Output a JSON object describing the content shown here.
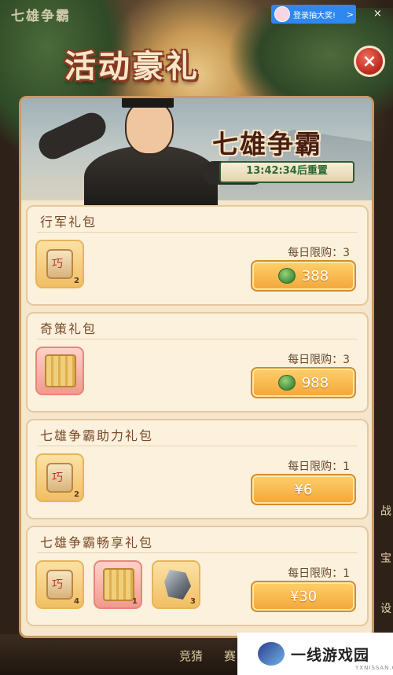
{
  "background": {
    "top_text": "七雄争霸",
    "bottom_left": "竞猜",
    "bottom_right": "赛",
    "side_chars": [
      "战",
      "宝",
      "设"
    ]
  },
  "ad": {
    "label": "登录抽大奖!",
    "chevron": ">",
    "close": "×"
  },
  "popup": {
    "title": "活动豪礼",
    "close_label": "×",
    "banner": {
      "event_name": "七雄争霸",
      "timer": "13:42:34后重置"
    },
    "packs": [
      {
        "name": "行军礼包",
        "limit": "每日限购：3",
        "price": "388",
        "price_type": "jade",
        "items": [
          {
            "icon": "qiao-scroll-icon",
            "count": "2",
            "style": "gold"
          }
        ]
      },
      {
        "name": "奇策礼包",
        "limit": "每日限购：3",
        "price": "988",
        "price_type": "jade",
        "items": [
          {
            "icon": "gold-scroll-icon",
            "count": "",
            "style": "pink"
          }
        ]
      },
      {
        "name": "七雄争霸助力礼包",
        "limit": "每日限购：1",
        "price": "¥6",
        "price_type": "cash",
        "items": [
          {
            "icon": "qiao-scroll-icon",
            "count": "2",
            "style": "gold"
          }
        ]
      },
      {
        "name": "七雄争霸畅享礼包",
        "limit": "每日限购：1",
        "price": "¥30",
        "price_type": "cash",
        "items": [
          {
            "icon": "qiao-scroll-icon",
            "count": "4",
            "style": "gold"
          },
          {
            "icon": "gold-scroll-icon",
            "count": "1",
            "style": "pink"
          },
          {
            "icon": "ore-icon",
            "count": "3",
            "style": "gold"
          }
        ]
      }
    ]
  },
  "watermark": {
    "brand": "一线游戏园",
    "url": "YXNISSAN.COM"
  },
  "colors": {
    "button": "#f2a63a",
    "timer_text": "#2b6a31",
    "close_red": "#b8281d"
  }
}
